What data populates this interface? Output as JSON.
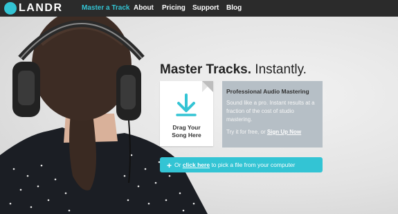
{
  "nav": {
    "brand": "LANDR",
    "items": [
      {
        "label": "Master a Track"
      },
      {
        "label": "About"
      },
      {
        "label": "Pricing"
      },
      {
        "label": "Support"
      },
      {
        "label": "Blog"
      }
    ]
  },
  "hero": {
    "headline_bold": "Master Tracks.",
    "headline_rest": " Instantly.",
    "drop": {
      "line1": "Drag Your",
      "line2": "Song Here",
      "icon": "download-arrow-icon"
    },
    "info": {
      "title": "Professional Audio Mastering",
      "body": "Sound like a pro. Instant results at a fraction of the cost of studio mastering.",
      "cta_prefix": "Try it for free, or ",
      "cta_link": "Sign Up Now"
    },
    "pick": {
      "prefix": "Or ",
      "link": "click here",
      "suffix": " to pick a file from your computer"
    }
  },
  "colors": {
    "accent": "#33c4d4",
    "nav_bg": "#2b2b2b",
    "info_bg": "#b6bfc6"
  }
}
